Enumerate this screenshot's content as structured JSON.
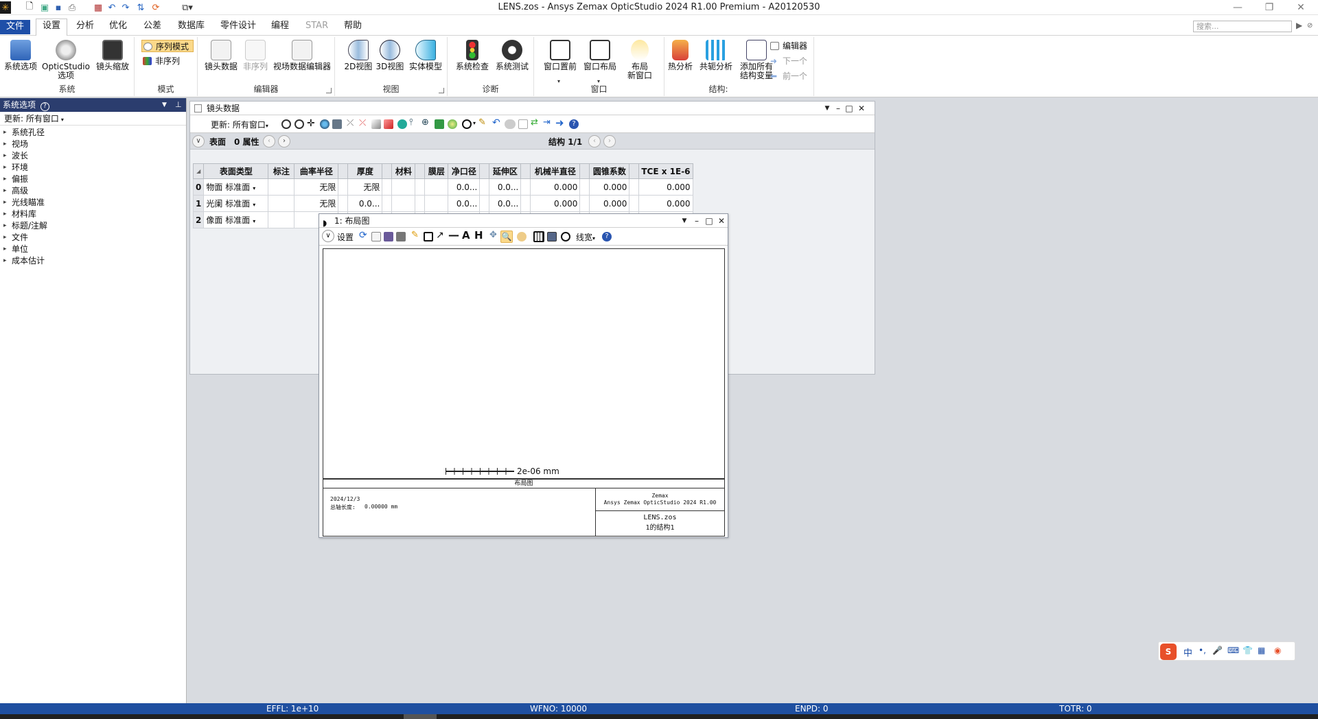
{
  "window": {
    "title": "LENS.zos - Ansys Zemax OpticStudio 2024 R1.00   Premium - A20120530"
  },
  "menu": {
    "tabs": [
      "文件",
      "设置",
      "分析",
      "优化",
      "公差",
      "数据库",
      "零件设计",
      "编程",
      "STAR",
      "帮助"
    ],
    "search_placeholder": "搜索..."
  },
  "ribbon": {
    "system": {
      "label": "系统",
      "btn1": "系统选项",
      "btn2a": "OpticStudio",
      "btn2b": "选项",
      "btn3": "镜头缩放"
    },
    "mode": {
      "label": "模式",
      "seq": "序列模式",
      "nonseq": "非序列"
    },
    "editors": {
      "label": "编辑器",
      "lens": "镜头数据",
      "nonseq": "非序列",
      "field": "视场数据编辑器"
    },
    "view": {
      "label": "视图",
      "v2d": "2D视图",
      "v3d": "3D视图",
      "solid": "实体模型"
    },
    "diag": {
      "label": "诊断",
      "check": "系统检查",
      "test": "系统测试"
    },
    "window": {
      "label": "窗口",
      "front": "窗口置前",
      "layout": "窗口布局",
      "newa": "布局",
      "newb": "新窗口"
    },
    "config": {
      "label": "结构:",
      "thermal": "热分析",
      "conj": "共轭分析",
      "adda": "添加所有",
      "addb": "结构变量",
      "editor": "编辑器",
      "next": "下一个",
      "prev": "前一个"
    }
  },
  "left_panel": {
    "title": "系统选项",
    "update": "更新: 所有窗口",
    "items": [
      "系统孔径",
      "视场",
      "波长",
      "环境",
      "偏振",
      "高级",
      "光线瞄准",
      "材料库",
      "标题/注解",
      "文件",
      "单位",
      "成本估计"
    ]
  },
  "lens_window": {
    "title": "镜头数据",
    "update": "更新: 所有窗口",
    "surface_label": "表面",
    "props_label": "0 属性",
    "config_label": "结构 1/1",
    "columns": [
      "表面类型",
      "标注",
      "曲率半径",
      "厚度",
      "材料",
      "膜层",
      "净口径",
      "延伸区",
      "机械半直径",
      "圆锥系数",
      "TCE x 1E-6"
    ],
    "rows": [
      {
        "n": "0",
        "name": "物面",
        "type": "标准面",
        "radius": "无限",
        "thick": "无限",
        "clear": "0.0...",
        "chip": "0.0...",
        "mech": "0.000",
        "conic": "0.000",
        "tce": "0.000"
      },
      {
        "n": "1",
        "name": "光阑",
        "type": "标准面",
        "radius": "无限",
        "thick": "0.0...",
        "clear": "0.0...",
        "chip": "0.0...",
        "mech": "0.000",
        "conic": "0.000",
        "tce": "0.000"
      },
      {
        "n": "2",
        "name": "像面",
        "type": "标准面",
        "radius": "无",
        "thick": "",
        "clear": "",
        "chip": "",
        "mech": "",
        "conic": "",
        "tce": ""
      }
    ]
  },
  "layout_window": {
    "title": "1: 布局图",
    "settings": "设置",
    "linewidth": "线宽",
    "scale": "2e-06 mm",
    "plot_title": "布局图",
    "date": "2024/12/3",
    "total_len_label": "总轴长度:",
    "total_len_value": "0.00000 mm",
    "company": "Zemax",
    "product": "Ansys Zemax OpticStudio 2024 R1.00",
    "file": "LENS.zos",
    "config": "1的结构1"
  },
  "status": {
    "effl": "EFFL: 1e+10",
    "wfno": "WFNO: 10000",
    "enpd": "ENPD: 0",
    "totr": "TOTR: 0"
  },
  "colors": {
    "accent": "#1f4fa0",
    "panel_header": "#2b3d6e",
    "mode_highlight": "#fbd98a"
  }
}
